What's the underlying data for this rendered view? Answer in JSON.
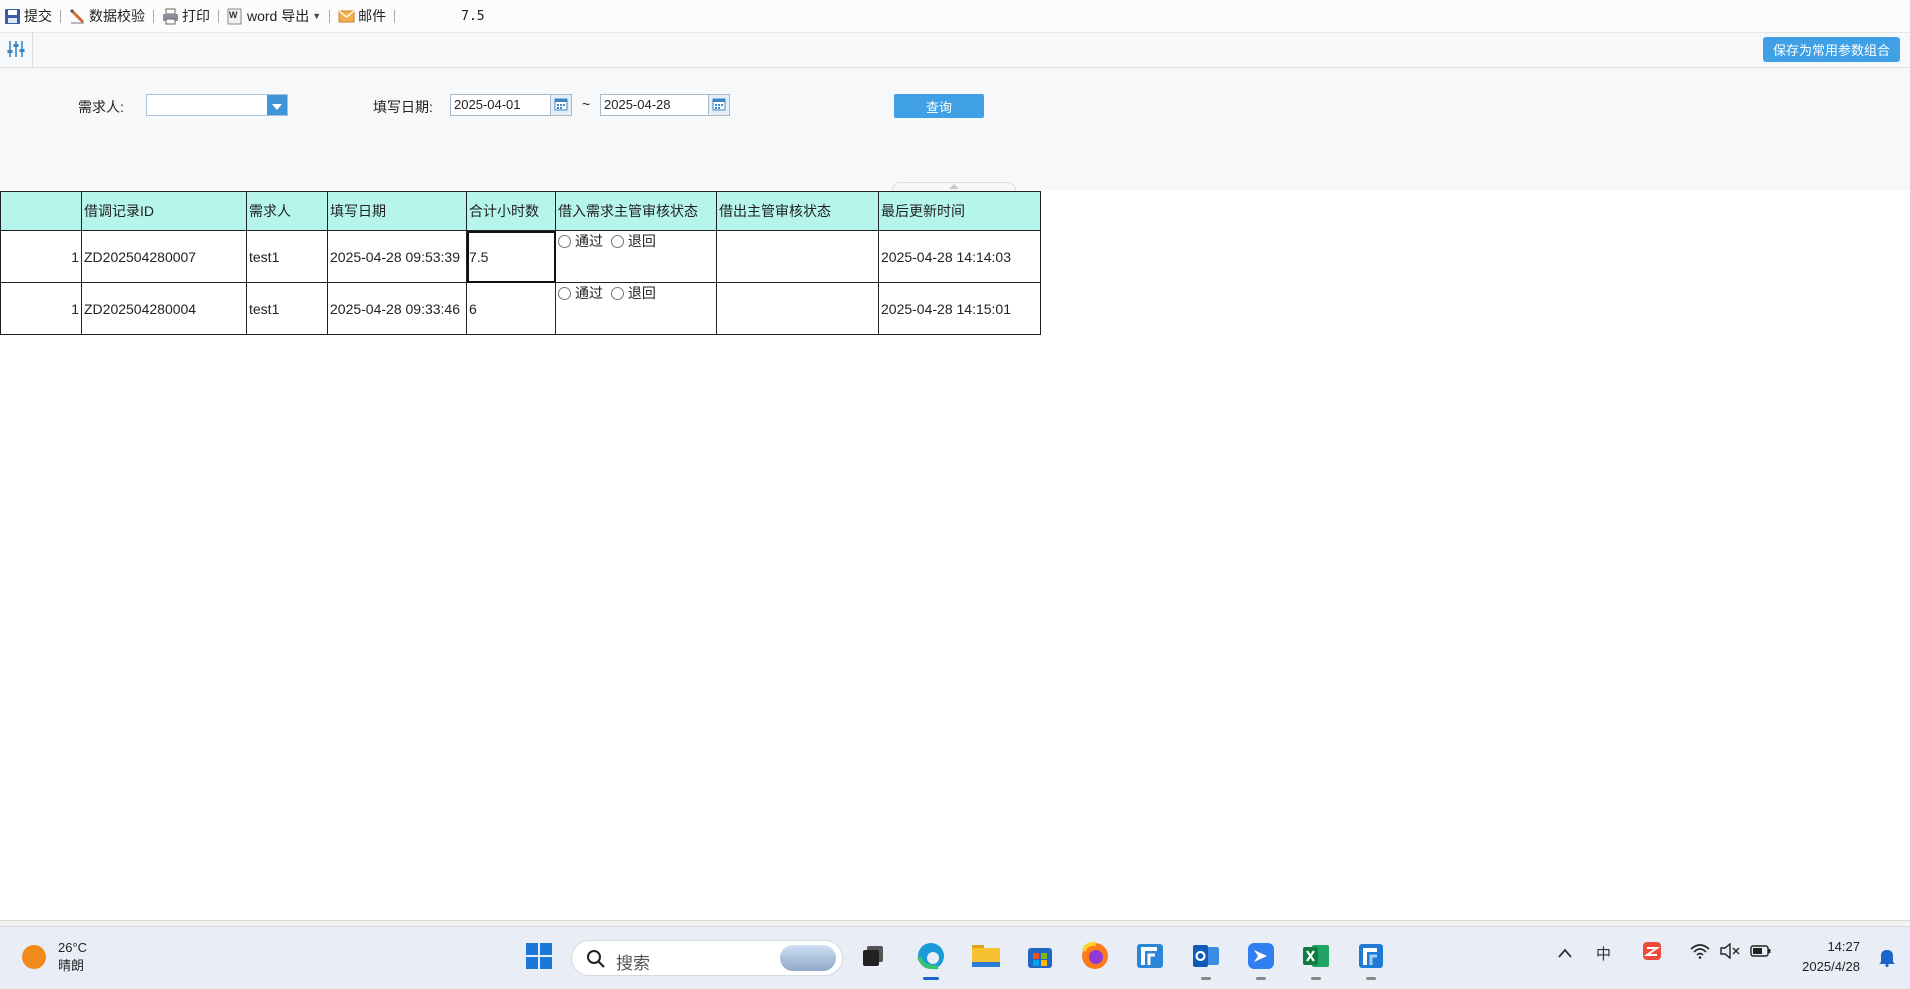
{
  "toolbar": {
    "items": [
      {
        "label": "提交",
        "icon": "save-icon"
      },
      {
        "label": "数据校验",
        "icon": "pencil-icon"
      },
      {
        "label": "打印",
        "icon": "printer-icon"
      },
      {
        "label": "word 导出",
        "icon": "word-icon"
      },
      {
        "label": "邮件",
        "icon": "mail-icon"
      }
    ],
    "current_value": "7.5"
  },
  "subbar": {
    "settings_icon": "sliders-icon",
    "save_combo_label": "保存为常用参数组合"
  },
  "filters": {
    "requester_label": "需求人:",
    "requester_value": "",
    "date_label": "填写日期:",
    "date_from": "2025-04-01",
    "date_sep": "~",
    "date_to": "2025-04-28",
    "query_label": "查询"
  },
  "grid": {
    "columns": [
      "",
      "借调记录ID",
      "需求人",
      "填写日期",
      "合计小时数",
      "借入需求主管审核状态",
      "借出主管审核状态",
      "最后更新时间"
    ],
    "radio_labels": {
      "approve": "通过",
      "reject": "退回"
    },
    "rows": [
      {
        "num": "1",
        "id": "ZD202504280007",
        "requester": "test1",
        "date": "2025-04-28 09:53:39",
        "hours": "7.5",
        "out_status": "",
        "updated": "2025-04-28 14:14:03"
      },
      {
        "num": "1",
        "id": "ZD202504280004",
        "requester": "test1",
        "date": "2025-04-28 09:33:46",
        "hours": "6",
        "out_status": "",
        "updated": "2025-04-28 14:15:01"
      }
    ]
  },
  "taskbar": {
    "weather_temp": "26°C",
    "weather_desc": "晴朗",
    "search_placeholder": "搜索",
    "apps": [
      "windows-start-icon",
      "task-view-icon",
      "edge-icon",
      "file-explorer-icon",
      "store-icon",
      "firefox-icon",
      "fanruan-icon",
      "outlook-icon",
      "feishu-icon",
      "excel-icon",
      "fanruan-designer-icon"
    ],
    "tray": {
      "ime": "中",
      "time": "14:27",
      "date": "2025/4/28"
    }
  },
  "colors": {
    "accent": "#3fa0e6",
    "header_bg": "#b6f5ec",
    "panel_bg": "#f7f8fa"
  }
}
